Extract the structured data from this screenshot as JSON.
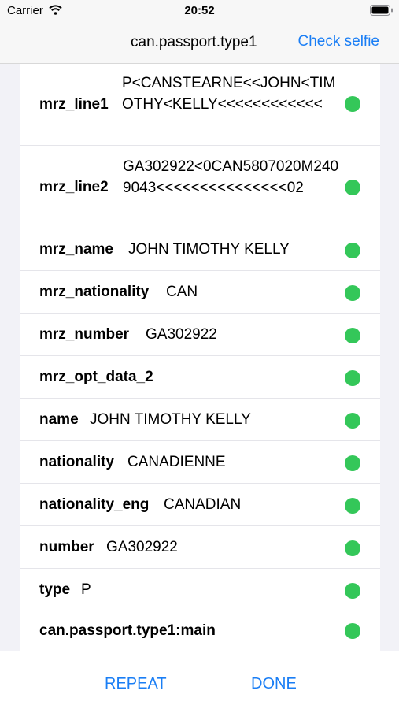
{
  "status_bar": {
    "carrier": "Carrier",
    "time": "20:52"
  },
  "nav": {
    "title": "can.passport.type1",
    "action": "Check selfie"
  },
  "rows": [
    {
      "label": "mrz_line1",
      "value": "P<CANSTEARNE<<JOHN<TIMOTHY<KELLY<<<<<<<<<<<<",
      "status": "valid"
    },
    {
      "label": "mrz_line2",
      "value": "GA302922<0CAN5807020M2409043<<<<<<<<<<<<<<<02",
      "status": "valid"
    },
    {
      "label": "mrz_name",
      "value": "JOHN TIMOTHY KELLY",
      "status": "valid"
    },
    {
      "label": "mrz_nationality",
      "value": "CAN",
      "status": "valid"
    },
    {
      "label": "mrz_number",
      "value": "GA302922",
      "status": "valid"
    },
    {
      "label": "mrz_opt_data_2",
      "value": "",
      "status": "valid"
    },
    {
      "label": "name",
      "value": "JOHN TIMOTHY KELLY",
      "status": "valid"
    },
    {
      "label": "nationality",
      "value": "CANADIENNE",
      "status": "valid"
    },
    {
      "label": "nationality_eng",
      "value": "CANADIAN",
      "status": "valid"
    },
    {
      "label": "number",
      "value": "GA302922",
      "status": "valid"
    },
    {
      "label": "type",
      "value": "P",
      "status": "valid"
    },
    {
      "label": "can.passport.type1:main",
      "value": "",
      "status": "valid"
    }
  ],
  "status_color": "#34c759",
  "accent_color": "#1a7ef5",
  "actions": {
    "repeat": "REPEAT",
    "done": "DONE"
  }
}
